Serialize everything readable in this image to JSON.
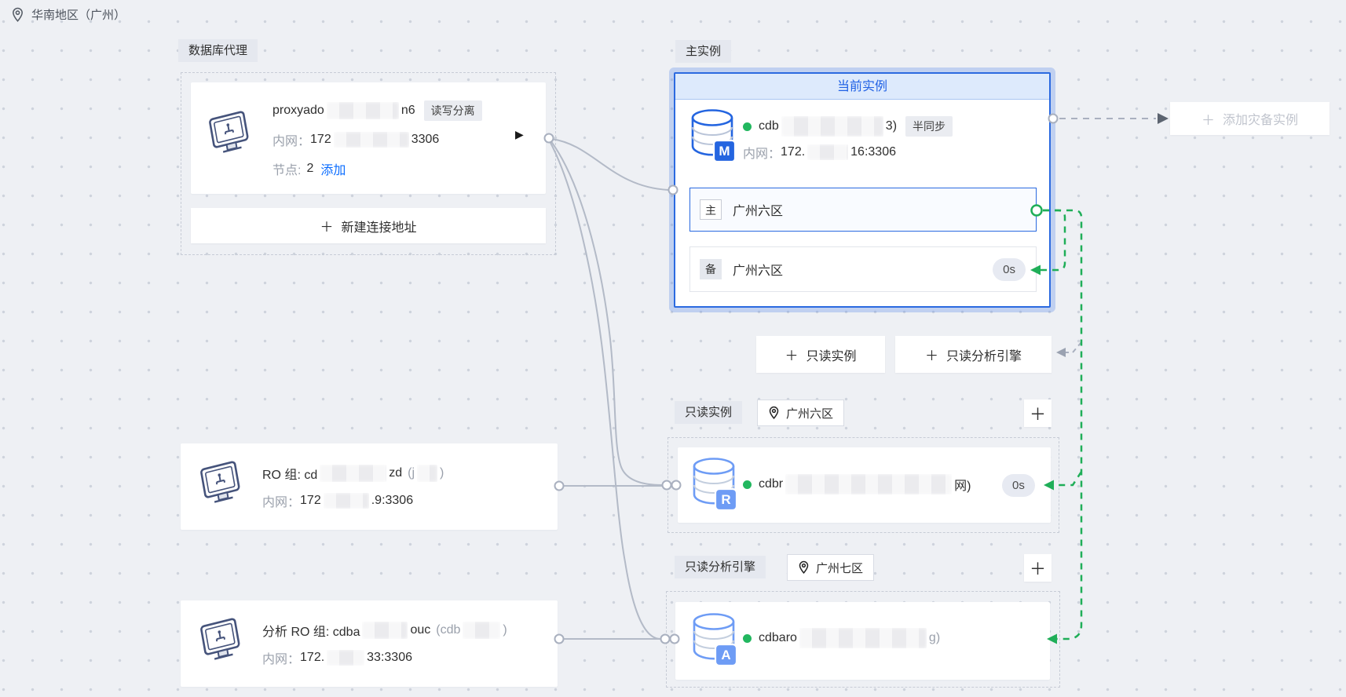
{
  "icons": {
    "plus": "＋",
    "play": "▶"
  },
  "region": {
    "label": "华南地区（广州）"
  },
  "proxy": {
    "section_tag": "数据库代理",
    "name_lead": "proxyado",
    "name_tail": "n6",
    "mode_tag": "读写分离",
    "ip_label": "内网：",
    "ip_lead": "172",
    "ip_tail": "3306",
    "node_label": "节点:",
    "node_value": "2",
    "add_link": "添加",
    "new_address_label": "新建连接地址"
  },
  "primary": {
    "section_tag": "主实例",
    "header": "当前实例",
    "badge": "M",
    "name_lead": "cdb",
    "name_tail": "3)",
    "sync_tag": "半同步",
    "ip_label": "内网：",
    "ip_lead": "172.",
    "ip_tail": "16:3306",
    "master": {
      "badge": "主",
      "zone": "广州六区"
    },
    "standby": {
      "badge": "备",
      "zone": "广州六区",
      "delay": "0s"
    }
  },
  "dr": {
    "button_label": "添加灾备实例"
  },
  "actions": {
    "add_readonly": "只读实例",
    "add_analysis": "只读分析引擎"
  },
  "readonly": {
    "section_tag": "只读实例",
    "zone": "广州六区",
    "badge": "R",
    "name_lead": "cdbr",
    "name_tail": "网)",
    "delay": "0s"
  },
  "analysis": {
    "section_tag": "只读分析引擎",
    "zone": "广州七区",
    "badge": "A",
    "name_lead": "cdbaro",
    "name_tail": "g)"
  },
  "ro_group": {
    "title_lead": "RO 组: cd",
    "title_mid": "zd",
    "paren_lead": "(j",
    "paren_tail": ")",
    "ip_label": "内网：",
    "ip_lead": "172",
    "ip_tail": ".9:3306"
  },
  "analysis_group": {
    "title_lead": "分析 RO 组: cdba",
    "title_mid": "ouc",
    "paren_lead": "(cdb",
    "paren_tail": ")",
    "ip_label": "内网：",
    "ip_lead": "172.",
    "ip_tail": "33:3306"
  },
  "colors": {
    "accent_blue": "#2b6ae0",
    "replication_green": "#1fae58",
    "link_blue": "#0a6cff"
  }
}
